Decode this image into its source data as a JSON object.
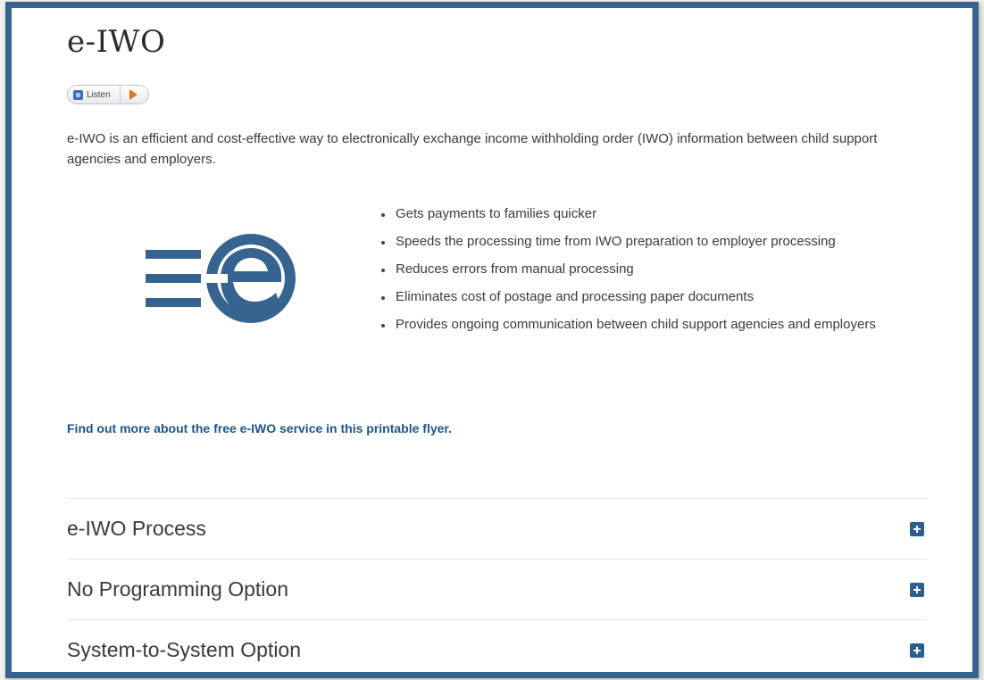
{
  "page": {
    "title": "e-IWO"
  },
  "listen": {
    "label": "Listen"
  },
  "intro": {
    "text": "e-IWO is an efficient and cost-effective way to electronically exchange income withholding order (IWO) information between child support agencies and employers."
  },
  "logo": {
    "icon": "e-iwo-logo",
    "color": "#36638f"
  },
  "benefits": [
    "Gets payments to families quicker",
    "Speeds the processing time from IWO preparation to employer processing",
    "Reduces errors from manual processing",
    "Eliminates cost of postage and processing paper documents",
    "Provides ongoing communication between child support agencies and employers"
  ],
  "flyer": {
    "link_text": "Find out more about the free e-IWO service in this printable flyer."
  },
  "accordion": [
    {
      "title": "e-IWO Process",
      "icon": "plus-icon"
    },
    {
      "title": "No Programming Option",
      "icon": "plus-icon"
    },
    {
      "title": "System-to-System Option",
      "icon": "plus-icon"
    }
  ],
  "colors": {
    "accent": "#36638f",
    "link": "#1f5585",
    "background": "#f3f0eb"
  }
}
